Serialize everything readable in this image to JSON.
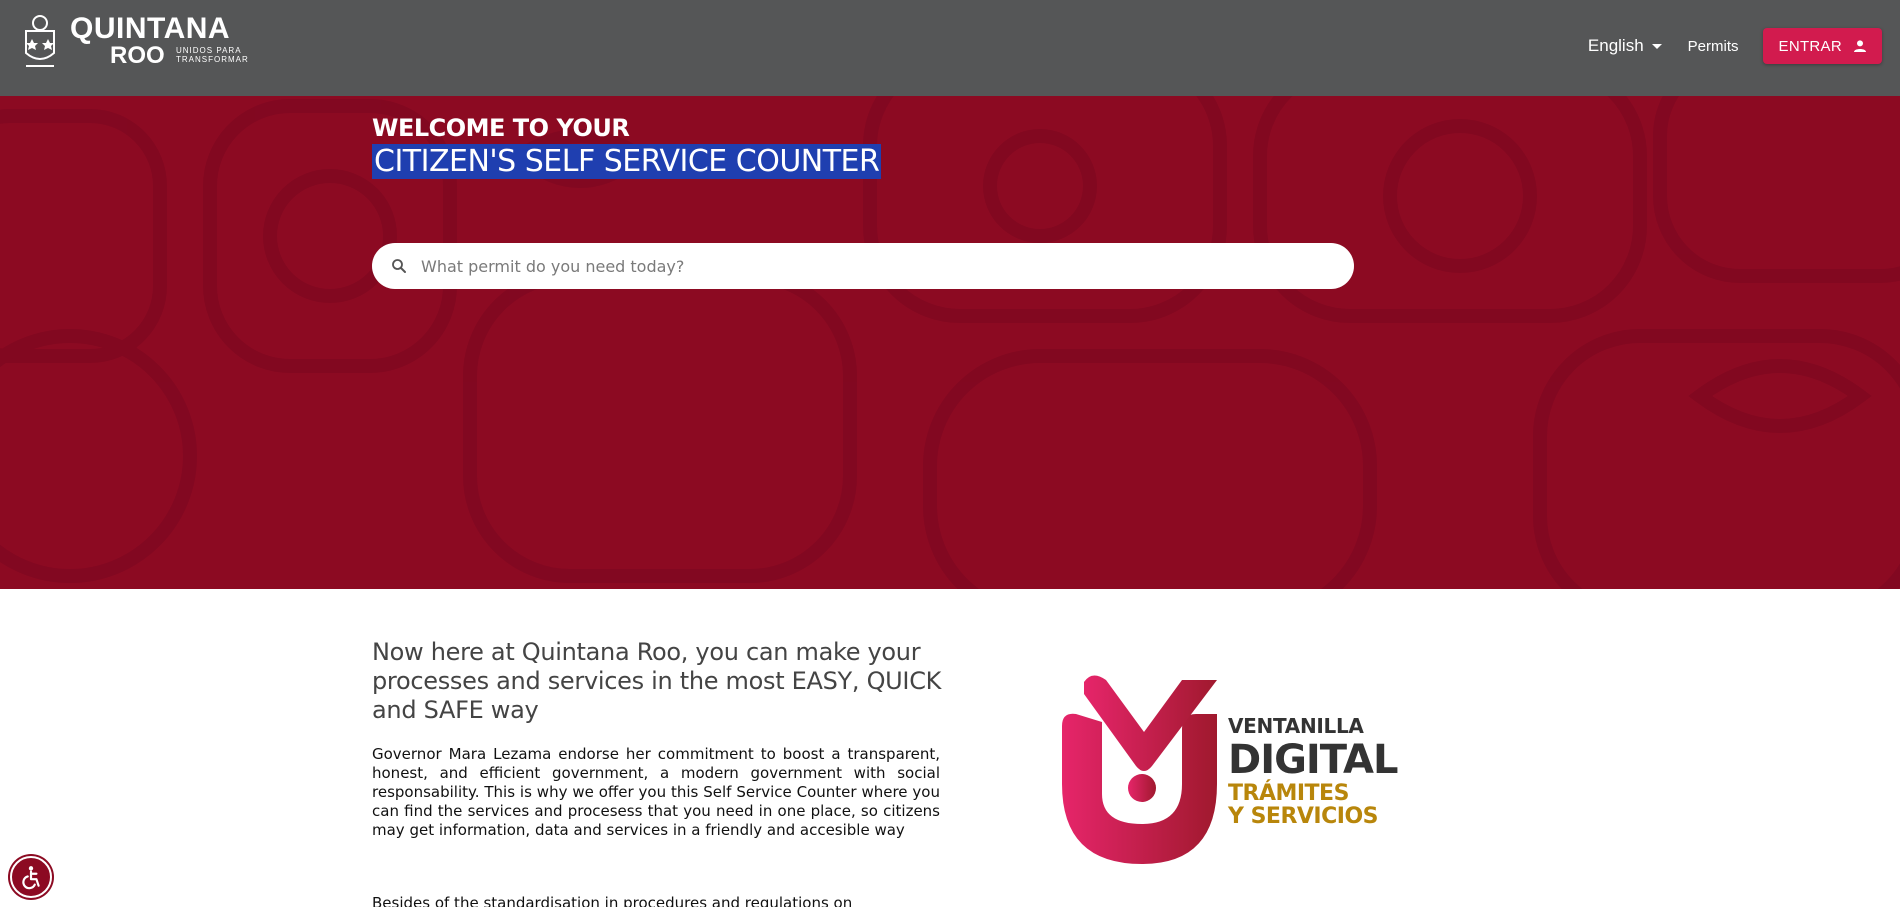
{
  "header": {
    "brand_top": "QUINTANA",
    "brand_bottom": "ROO",
    "brand_tagline": "UNIDOS PARA TRANSFORMAR",
    "language": "English",
    "permits_label": "Permits",
    "enter_label": "ENTRAR"
  },
  "hero": {
    "welcome": "WELCOME TO YOUR",
    "title": "CITIZEN'S SELF SERVICE COUNTER",
    "search_placeholder": "What permit do you need today?"
  },
  "intro": {
    "heading": "Now here at Quintana Roo, you can make your processes and services in the most EASY, QUICK and SAFE way",
    "body": "Governor Mara Lezama endorse her commitment to boost a transparent, honest, and efficient government, a modern government with social responsability. This is why we offer you this Self Service Counter where you can find the services and procesess that you need in one place, so citizens may get information, data and services in a friendly and accesible way",
    "body2": "Besides of the standardisation in procedures and regulations on"
  },
  "logo": {
    "line1": "VENTANILLA",
    "line2": "DIGITAL",
    "line3": "TRÁMITES",
    "line4": "Y SERVICIOS"
  },
  "colors": {
    "header_bg": "#555657",
    "hero_bg": "#8c0a22",
    "accent": "#d21b4e",
    "highlight": "#1f3fb0"
  },
  "icons": {
    "search": "search-icon",
    "user": "user-icon",
    "accessibility": "accessibility-icon"
  }
}
